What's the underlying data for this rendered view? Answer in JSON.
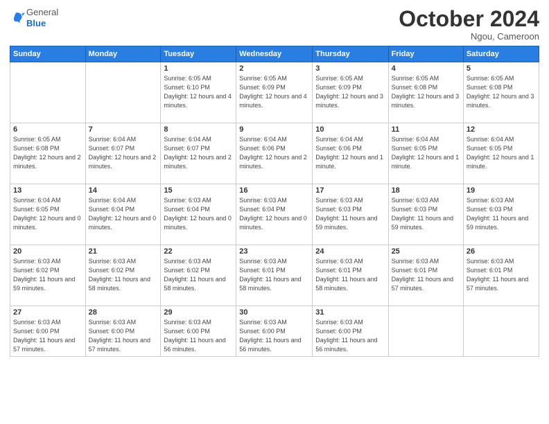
{
  "header": {
    "logo_line1": "General",
    "logo_line2": "Blue",
    "month": "October 2024",
    "location": "Ngou, Cameroon"
  },
  "weekdays": [
    "Sunday",
    "Monday",
    "Tuesday",
    "Wednesday",
    "Thursday",
    "Friday",
    "Saturday"
  ],
  "weeks": [
    [
      {
        "day": "",
        "info": ""
      },
      {
        "day": "",
        "info": ""
      },
      {
        "day": "1",
        "info": "Sunrise: 6:05 AM\nSunset: 6:10 PM\nDaylight: 12 hours and 4 minutes."
      },
      {
        "day": "2",
        "info": "Sunrise: 6:05 AM\nSunset: 6:09 PM\nDaylight: 12 hours and 4 minutes."
      },
      {
        "day": "3",
        "info": "Sunrise: 6:05 AM\nSunset: 6:09 PM\nDaylight: 12 hours and 3 minutes."
      },
      {
        "day": "4",
        "info": "Sunrise: 6:05 AM\nSunset: 6:08 PM\nDaylight: 12 hours and 3 minutes."
      },
      {
        "day": "5",
        "info": "Sunrise: 6:05 AM\nSunset: 6:08 PM\nDaylight: 12 hours and 3 minutes."
      }
    ],
    [
      {
        "day": "6",
        "info": "Sunrise: 6:05 AM\nSunset: 6:08 PM\nDaylight: 12 hours and 2 minutes."
      },
      {
        "day": "7",
        "info": "Sunrise: 6:04 AM\nSunset: 6:07 PM\nDaylight: 12 hours and 2 minutes."
      },
      {
        "day": "8",
        "info": "Sunrise: 6:04 AM\nSunset: 6:07 PM\nDaylight: 12 hours and 2 minutes."
      },
      {
        "day": "9",
        "info": "Sunrise: 6:04 AM\nSunset: 6:06 PM\nDaylight: 12 hours and 2 minutes."
      },
      {
        "day": "10",
        "info": "Sunrise: 6:04 AM\nSunset: 6:06 PM\nDaylight: 12 hours and 1 minute."
      },
      {
        "day": "11",
        "info": "Sunrise: 6:04 AM\nSunset: 6:05 PM\nDaylight: 12 hours and 1 minute."
      },
      {
        "day": "12",
        "info": "Sunrise: 6:04 AM\nSunset: 6:05 PM\nDaylight: 12 hours and 1 minute."
      }
    ],
    [
      {
        "day": "13",
        "info": "Sunrise: 6:04 AM\nSunset: 6:05 PM\nDaylight: 12 hours and 0 minutes."
      },
      {
        "day": "14",
        "info": "Sunrise: 6:04 AM\nSunset: 6:04 PM\nDaylight: 12 hours and 0 minutes."
      },
      {
        "day": "15",
        "info": "Sunrise: 6:03 AM\nSunset: 6:04 PM\nDaylight: 12 hours and 0 minutes."
      },
      {
        "day": "16",
        "info": "Sunrise: 6:03 AM\nSunset: 6:04 PM\nDaylight: 12 hours and 0 minutes."
      },
      {
        "day": "17",
        "info": "Sunrise: 6:03 AM\nSunset: 6:03 PM\nDaylight: 11 hours and 59 minutes."
      },
      {
        "day": "18",
        "info": "Sunrise: 6:03 AM\nSunset: 6:03 PM\nDaylight: 11 hours and 59 minutes."
      },
      {
        "day": "19",
        "info": "Sunrise: 6:03 AM\nSunset: 6:03 PM\nDaylight: 11 hours and 59 minutes."
      }
    ],
    [
      {
        "day": "20",
        "info": "Sunrise: 6:03 AM\nSunset: 6:02 PM\nDaylight: 11 hours and 59 minutes."
      },
      {
        "day": "21",
        "info": "Sunrise: 6:03 AM\nSunset: 6:02 PM\nDaylight: 11 hours and 58 minutes."
      },
      {
        "day": "22",
        "info": "Sunrise: 6:03 AM\nSunset: 6:02 PM\nDaylight: 11 hours and 58 minutes."
      },
      {
        "day": "23",
        "info": "Sunrise: 6:03 AM\nSunset: 6:01 PM\nDaylight: 11 hours and 58 minutes."
      },
      {
        "day": "24",
        "info": "Sunrise: 6:03 AM\nSunset: 6:01 PM\nDaylight: 11 hours and 58 minutes."
      },
      {
        "day": "25",
        "info": "Sunrise: 6:03 AM\nSunset: 6:01 PM\nDaylight: 11 hours and 57 minutes."
      },
      {
        "day": "26",
        "info": "Sunrise: 6:03 AM\nSunset: 6:01 PM\nDaylight: 11 hours and 57 minutes."
      }
    ],
    [
      {
        "day": "27",
        "info": "Sunrise: 6:03 AM\nSunset: 6:00 PM\nDaylight: 11 hours and 57 minutes."
      },
      {
        "day": "28",
        "info": "Sunrise: 6:03 AM\nSunset: 6:00 PM\nDaylight: 11 hours and 57 minutes."
      },
      {
        "day": "29",
        "info": "Sunrise: 6:03 AM\nSunset: 6:00 PM\nDaylight: 11 hours and 56 minutes."
      },
      {
        "day": "30",
        "info": "Sunrise: 6:03 AM\nSunset: 6:00 PM\nDaylight: 11 hours and 56 minutes."
      },
      {
        "day": "31",
        "info": "Sunrise: 6:03 AM\nSunset: 6:00 PM\nDaylight: 11 hours and 56 minutes."
      },
      {
        "day": "",
        "info": ""
      },
      {
        "day": "",
        "info": ""
      }
    ]
  ]
}
